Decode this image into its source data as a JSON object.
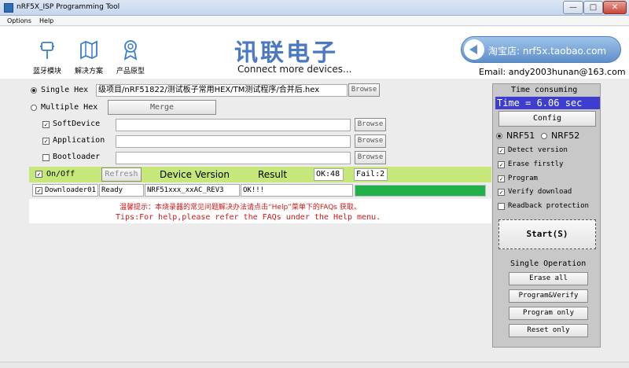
{
  "window": {
    "title": "nRF5X_ISP Programming Tool",
    "min": "—",
    "max": "□",
    "close": "✕"
  },
  "menu": {
    "options": "Options",
    "help": "Help"
  },
  "banner": {
    "nav": [
      "蓝牙模块",
      "解决方案",
      "产品原型"
    ],
    "brand": "讯联电子",
    "tagline": "Connect more devices...",
    "shop": "淘宝店: nrf5x.taobao.com",
    "email": "Email: andy2003hunan@163.com",
    "accent": "#4a78c2"
  },
  "hex": {
    "single_label": "Single Hex",
    "single_value": "级项目/nRF51822/测试板子常用HEX/TM测试程序/合并后.hex",
    "single_browse": "Browse",
    "multiple_label": "Multiple Hex",
    "merge": "Merge",
    "rows": [
      {
        "label": "SoftDevice",
        "checked": true,
        "value": "",
        "browse": "Browse"
      },
      {
        "label": "Application",
        "checked": true,
        "value": "",
        "browse": "Browse"
      },
      {
        "label": "Bootloader",
        "checked": false,
        "value": "",
        "browse": "Browse"
      }
    ]
  },
  "status": {
    "onoff": "On/Off",
    "refresh": "Refresh",
    "device_version": "Device Version",
    "result": "Result",
    "ok": "OK:48",
    "fail": "Fail:2",
    "bar_color": "#c6e87a"
  },
  "device": {
    "name": "Downloader01",
    "state": "Ready",
    "version": "NRF51xxx_xxAC_REV3",
    "result": "OK!!!",
    "progress": 1.0,
    "progress_color": "#20b14a"
  },
  "tips": {
    "cn": "温馨提示：本烧录器的常见问题解决办法请点击“Help”菜单下的FAQs 获取。",
    "en": "Tips:For help,please refer the FAQs under the Help menu.",
    "color": "#d01616"
  },
  "side": {
    "time_title": "Time consuming",
    "time_value": "Time = 6.06 sec",
    "config": "Config",
    "chip_options": [
      "NRF51",
      "NRF52"
    ],
    "chip_selected": "NRF51",
    "checks": [
      {
        "label": "Detect version",
        "checked": true
      },
      {
        "label": "Erase firstly",
        "checked": true
      },
      {
        "label": "Program",
        "checked": true
      },
      {
        "label": "Verify download",
        "checked": true
      },
      {
        "label": "Readback protection",
        "checked": false
      }
    ],
    "start": "Start(S)",
    "single_op_title": "Single Operation",
    "ops": [
      "Erase all",
      "Program&Verify",
      "Program only",
      "Reset only"
    ]
  }
}
